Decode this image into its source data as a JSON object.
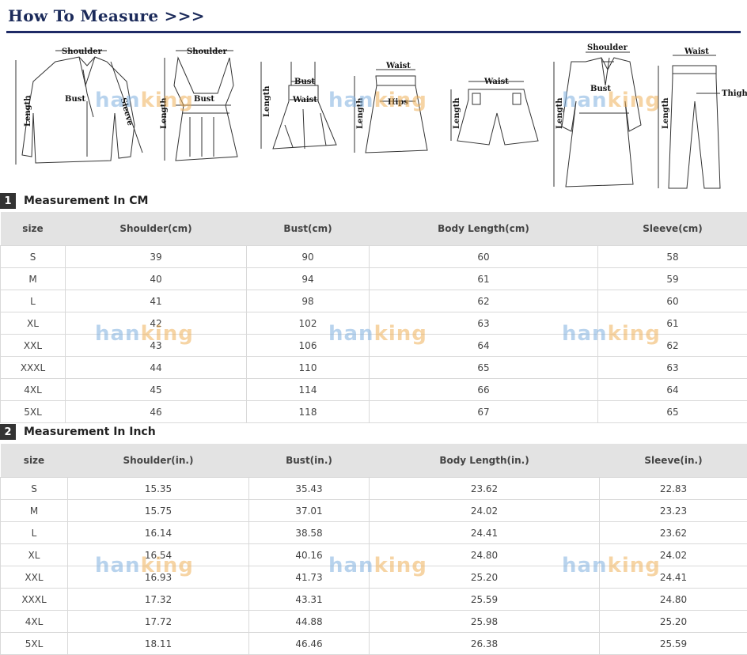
{
  "header": {
    "title": "How To Measure >>>"
  },
  "figure_labels": {
    "shoulder": "Shoulder",
    "bust": "Bust",
    "length": "Length",
    "sleeve": "Sleeve",
    "waist": "Waist",
    "hips": "Hips",
    "thigh": "Thigh"
  },
  "watermark": {
    "part1": "han",
    "part2": "king"
  },
  "colors": {
    "header": "#1b2a5a",
    "rule": "#1e2a66",
    "table_header_bg": "#e3e3e3",
    "badge_bg": "#333333"
  },
  "cm_section": {
    "number": "1",
    "title": "Measurement In CM",
    "headers": [
      "size",
      "Shoulder(cm)",
      "Bust(cm)",
      "Body Length(cm)",
      "Sleeve(cm)"
    ],
    "rows": [
      [
        "S",
        "39",
        "90",
        "60",
        "58"
      ],
      [
        "M",
        "40",
        "94",
        "61",
        "59"
      ],
      [
        "L",
        "41",
        "98",
        "62",
        "60"
      ],
      [
        "XL",
        "42",
        "102",
        "63",
        "61"
      ],
      [
        "XXL",
        "43",
        "106",
        "64",
        "62"
      ],
      [
        "XXXL",
        "44",
        "110",
        "65",
        "63"
      ],
      [
        "4XL",
        "45",
        "114",
        "66",
        "64"
      ],
      [
        "5XL",
        "46",
        "118",
        "67",
        "65"
      ]
    ]
  },
  "inch_section": {
    "number": "2",
    "title": "Measurement In Inch",
    "headers": [
      "size",
      "Shoulder(in.)",
      "Bust(in.)",
      "Body Length(in.)",
      "Sleeve(in.)"
    ],
    "rows": [
      [
        "S",
        "15.35",
        "35.43",
        "23.62",
        "22.83"
      ],
      [
        "M",
        "15.75",
        "37.01",
        "24.02",
        "23.23"
      ],
      [
        "L",
        "16.14",
        "38.58",
        "24.41",
        "23.62"
      ],
      [
        "XL",
        "16.54",
        "40.16",
        "24.80",
        "24.02"
      ],
      [
        "XXL",
        "16.93",
        "41.73",
        "25.20",
        "24.41"
      ],
      [
        "XXXL",
        "17.32",
        "43.31",
        "25.59",
        "24.80"
      ],
      [
        "4XL",
        "17.72",
        "44.88",
        "25.98",
        "25.20"
      ],
      [
        "5XL",
        "18.11",
        "46.46",
        "26.38",
        "25.59"
      ]
    ]
  }
}
